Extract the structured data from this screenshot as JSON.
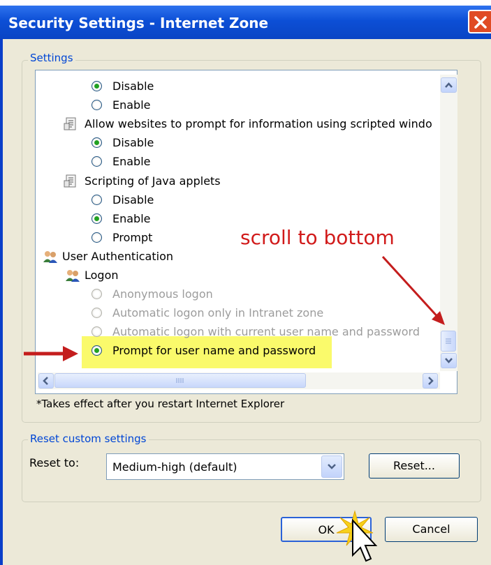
{
  "window": {
    "title": "Security Settings - Internet Zone"
  },
  "settings_group": {
    "legend": "Settings",
    "rows": [
      {
        "kind": "radio",
        "label": "Disable",
        "checked": true,
        "disabled": false
      },
      {
        "kind": "radio",
        "label": "Enable",
        "checked": false,
        "disabled": false
      },
      {
        "kind": "script",
        "label": "Allow websites to prompt for information using scripted windo"
      },
      {
        "kind": "radio",
        "label": "Disable",
        "checked": true,
        "disabled": false
      },
      {
        "kind": "radio",
        "label": "Enable",
        "checked": false,
        "disabled": false
      },
      {
        "kind": "script",
        "label": "Scripting of Java applets"
      },
      {
        "kind": "radio",
        "label": "Disable",
        "checked": false,
        "disabled": false
      },
      {
        "kind": "radio",
        "label": "Enable",
        "checked": true,
        "disabled": false
      },
      {
        "kind": "radio",
        "label": "Prompt",
        "checked": false,
        "disabled": false
      },
      {
        "kind": "people",
        "label": "User Authentication"
      },
      {
        "kind": "people",
        "label": "Logon"
      },
      {
        "kind": "radio",
        "label": "Anonymous logon",
        "checked": false,
        "disabled": true
      },
      {
        "kind": "radio",
        "label": "Automatic logon only in Intranet zone",
        "checked": false,
        "disabled": true
      },
      {
        "kind": "radio",
        "label": "Automatic logon with current user name and password",
        "checked": false,
        "disabled": true
      },
      {
        "kind": "radio",
        "label": "Prompt for user name and password",
        "checked": true,
        "disabled": false
      }
    ],
    "note": "*Takes effect after you restart Internet Explorer"
  },
  "reset_group": {
    "legend": "Reset custom settings",
    "reset_to_label": "Reset to:",
    "selected": "Medium-high (default)",
    "reset_button": "Reset..."
  },
  "footer": {
    "ok": "OK",
    "cancel": "Cancel"
  },
  "annotation": {
    "text": "scroll to bottom",
    "color": "#d11a1a"
  },
  "colors": {
    "title_bar": "#0c4fd6",
    "highlight": "#fafa6b",
    "checked_radio": "#21a121"
  }
}
